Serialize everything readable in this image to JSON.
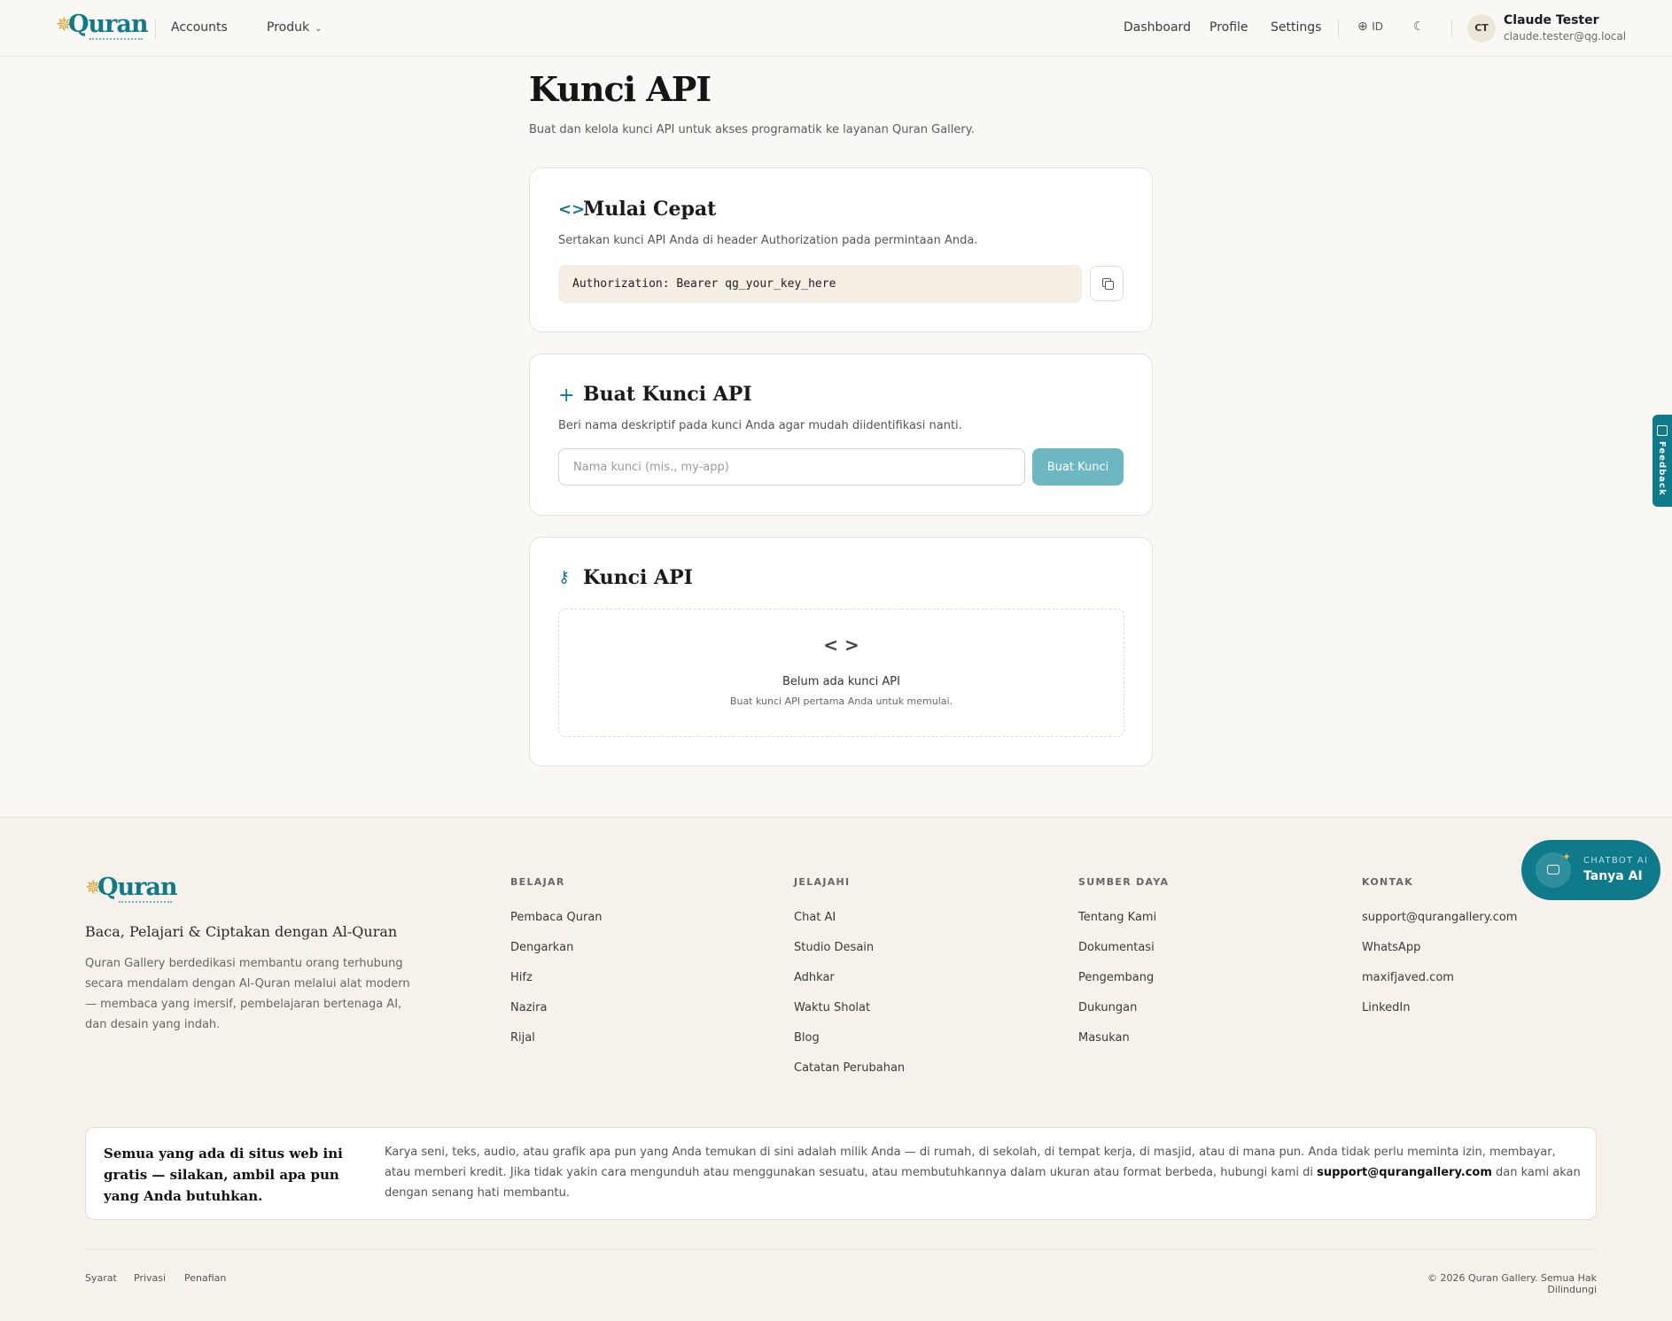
{
  "header": {
    "logo_text": "Quran",
    "nav": [
      {
        "label": "Accounts"
      },
      {
        "label": "Produk"
      }
    ],
    "right_links": [
      {
        "label": "Dashboard"
      },
      {
        "label": "Profile"
      },
      {
        "label": "Settings"
      }
    ],
    "language": "ID",
    "user": {
      "initials": "CT",
      "name": "Claude Tester",
      "email": "claude.tester@qg.local"
    }
  },
  "page": {
    "title": "Kunci API",
    "subtitle": "Buat dan kelola kunci API untuk akses programatik ke layanan Quran Gallery."
  },
  "quickstart": {
    "title": "Mulai Cepat",
    "description": "Sertakan kunci API Anda di header Authorization pada permintaan Anda.",
    "code": "Authorization: Bearer qg_your_key_here"
  },
  "create": {
    "title": "Buat Kunci API",
    "description": "Beri nama deskriptif pada kunci Anda agar mudah diidentifikasi nanti.",
    "placeholder": "Nama kunci (mis., my-app)",
    "button": "Buat Kunci"
  },
  "keys": {
    "title": "Kunci API",
    "empty_title": "Belum ada kunci API",
    "empty_sub": "Buat kunci API pertama Anda untuk memulai."
  },
  "feedback_tab": "Feedback",
  "chatbot": {
    "label_small": "CHATBOT AI",
    "label": "Tanya AI"
  },
  "footer": {
    "tagline": "Baca, Pelajari & Ciptakan dengan Al-Quran",
    "description": "Quran Gallery berdedikasi membantu orang terhubung secara mendalam dengan Al-Quran melalui alat modern — membaca yang imersif, pembelajaran bertenaga AI, dan desain yang indah.",
    "columns": [
      {
        "heading": "BELAJAR",
        "links": [
          "Pembaca Quran",
          "Dengarkan",
          "Hifz",
          "Nazira",
          "Rijal"
        ]
      },
      {
        "heading": "JELAJAHI",
        "links": [
          "Chat AI",
          "Studio Desain",
          "Adhkar",
          "Waktu Sholat",
          "Blog",
          "Catatan Perubahan"
        ]
      },
      {
        "heading": "SUMBER DAYA",
        "links": [
          "Tentang Kami",
          "Dokumentasi",
          "Pengembang",
          "Dukungan",
          "Masukan"
        ]
      },
      {
        "heading": "KONTAK",
        "links": [
          "support@qurangallery.com",
          "WhatsApp",
          "maxifjaved.com",
          "LinkedIn"
        ]
      }
    ],
    "free_title": "Semua yang ada di situs web ini gratis — silakan, ambil apa pun yang Anda butuhkan.",
    "free_text_before": "Karya seni, teks, audio, atau grafik apa pun yang Anda temukan di sini adalah milik Anda — di rumah, di sekolah, di tempat kerja, di masjid, atau di mana pun. Anda tidak perlu meminta izin, membayar, atau memberi kredit. Jika tidak yakin cara mengunduh atau menggunakan sesuatu, atau membutuhkannya dalam ukuran atau format berbeda, hubungi kami di ",
    "free_text_email": "support@qurangallery.com",
    "free_text_after": " dan kami akan dengan senang hati membantu.",
    "legal": [
      "Syarat",
      "Privasi",
      "Penafian"
    ],
    "copyright": "© 2026 Quran Gallery. Semua Hak Dilindungi"
  },
  "colors": {
    "accent": "#0f7a8a",
    "button_disabled": "#6db7c3",
    "background": "#faf8f4",
    "gold": "#d8a33a"
  }
}
